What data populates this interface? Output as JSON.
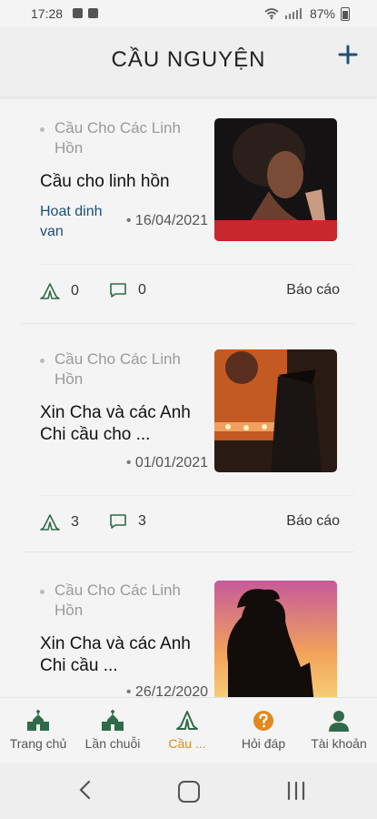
{
  "status": {
    "time": "17:28",
    "battery": "87%"
  },
  "header": {
    "title": "CẦU NGUYỆN",
    "add_icon": "plus-icon"
  },
  "cards": [
    {
      "category": "Cầu Cho Các Linh Hồn",
      "title": "Cầu cho linh hồn",
      "author": "Hoat dinh van",
      "date": "16/04/2021",
      "pray_count": "0",
      "comment_count": "0",
      "report": "Báo cáo"
    },
    {
      "category": "Cầu Cho Các Linh Hồn",
      "title": "Xin Cha và các Anh Chi cầu cho ...",
      "author": "",
      "date": "01/01/2021",
      "pray_count": "3",
      "comment_count": "3",
      "report": "Báo cáo"
    },
    {
      "category": "Cầu Cho Các Linh Hồn",
      "title": "Xin Cha và các Anh Chi cầu ...",
      "author": "",
      "date": "26/12/2020",
      "pray_count": "",
      "comment_count": "",
      "report": ""
    }
  ],
  "tabs": [
    {
      "label": "Trang chủ",
      "icon": "church-icon"
    },
    {
      "label": "Lần chuỗi",
      "icon": "church-icon"
    },
    {
      "label": "Cầu ...",
      "icon": "praying-hands-icon",
      "active": true
    },
    {
      "label": "Hỏi đáp",
      "icon": "question-icon"
    },
    {
      "label": "Tài khoản",
      "icon": "person-icon"
    }
  ],
  "colors": {
    "accent": "#e08a1e",
    "brand": "#1e4f7a",
    "icon_green": "#2f6b4a"
  }
}
